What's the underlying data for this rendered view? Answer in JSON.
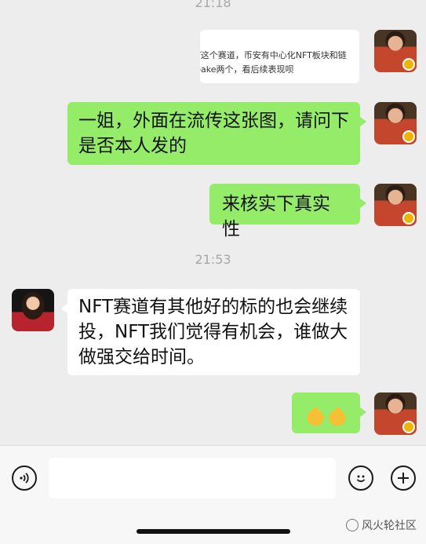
{
  "timestamps": [
    "21:18",
    "21:53"
  ],
  "quoted_message": {
    "line1": "T这个赛道，币安有中心化NFT板块和链",
    "line2": "bake两个，看后续表现呗"
  },
  "messages": [
    {
      "side": "right",
      "text_line1": "一姐，外面在流传这张图，请问下",
      "text_line2": "是否本人发的"
    },
    {
      "side": "right",
      "text": "来核实下真实性"
    },
    {
      "side": "left",
      "text_line1": "NFT赛道有其他好的标的也会继续",
      "text_line2": "投，NFT我们觉得有机会，谁做大",
      "text_line3": "做强交给时间。"
    },
    {
      "side": "right",
      "emoji": [
        "thumbs-up",
        "thumbs-up"
      ]
    }
  ],
  "input_bar": {
    "placeholder": ""
  },
  "watermark": "风火轮社区",
  "colors": {
    "background": "#ededed",
    "sent_bubble": "#95ec69",
    "received_bubble": "#ffffff",
    "badge": "#f0b400"
  }
}
